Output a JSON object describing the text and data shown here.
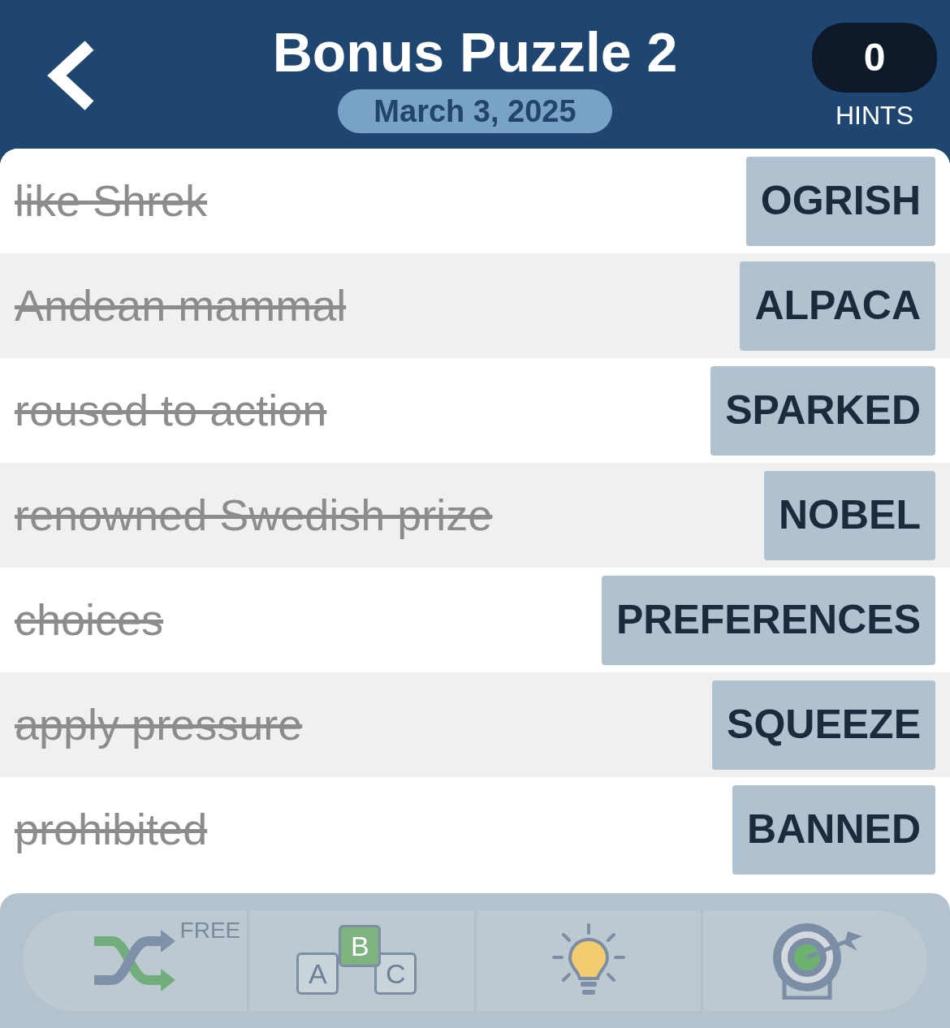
{
  "header": {
    "title": "Bonus Puzzle 2",
    "date": "March 3, 2025",
    "hints": {
      "count": "0",
      "label": "HINTS"
    }
  },
  "clues": [
    {
      "clue": "like Shrek",
      "answer": "OGRISH",
      "solved": true
    },
    {
      "clue": "Andean mammal",
      "answer": "ALPACA",
      "solved": true
    },
    {
      "clue": "roused to action",
      "answer": "SPARKED",
      "solved": true
    },
    {
      "clue": "renowned Swedish prize",
      "answer": "NOBEL",
      "solved": true
    },
    {
      "clue": "choices",
      "answer": "PREFERENCES",
      "solved": true
    },
    {
      "clue": "apply pressure",
      "answer": "SQUEEZE",
      "solved": true
    },
    {
      "clue": "prohibited",
      "answer": "BANNED",
      "solved": true
    }
  ],
  "toolbar": [
    {
      "kind": "shuffle",
      "badge": "FREE"
    },
    {
      "kind": "letters",
      "letters": [
        "A",
        "B",
        "C"
      ]
    },
    {
      "kind": "hint"
    },
    {
      "kind": "target"
    }
  ]
}
